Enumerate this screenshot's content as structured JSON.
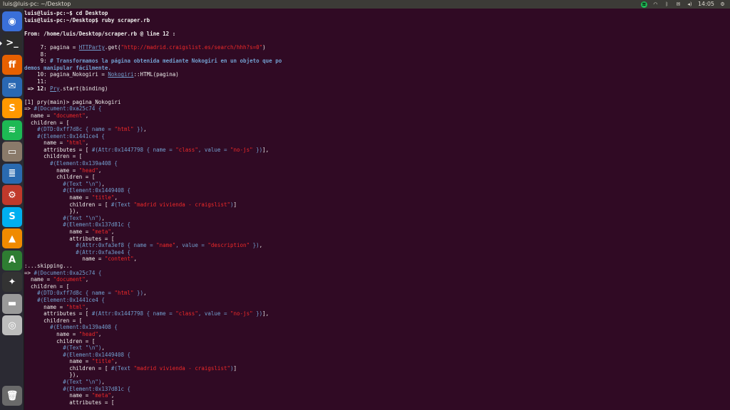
{
  "window_title": "luis@luis-pc: ~/Desktop",
  "clock": "14:05",
  "tray_icons": [
    "spotify-icon",
    "wifi-icon",
    "bluetooth-icon",
    "mail-icon",
    "volume-icon",
    "power-icon"
  ],
  "launcher": [
    {
      "name": "dash-home-icon",
      "glyph": "◉",
      "color": "#3a6fd8"
    },
    {
      "name": "terminal-icon",
      "glyph": ">_",
      "color": "#2c2c2c"
    },
    {
      "name": "firefox-icon",
      "glyph": "ff",
      "color": "#e66000"
    },
    {
      "name": "thunderbird-icon",
      "glyph": "✉",
      "color": "#2a68b3"
    },
    {
      "name": "sublime-text-icon",
      "glyph": "S",
      "color": "#ff9800"
    },
    {
      "name": "spotify-icon",
      "glyph": "≋",
      "color": "#1db954"
    },
    {
      "name": "files-icon",
      "glyph": "▭",
      "color": "#8a7a6a"
    },
    {
      "name": "writer-icon",
      "glyph": "≣",
      "color": "#2a6ab0"
    },
    {
      "name": "system-settings-icon",
      "glyph": "⚙",
      "color": "#c0392b"
    },
    {
      "name": "skype-icon",
      "glyph": "S",
      "color": "#00aff0"
    },
    {
      "name": "vlc-icon",
      "glyph": "▲",
      "color": "#f08a00"
    },
    {
      "name": "software-updater-icon",
      "glyph": "A",
      "color": "#2e7d32"
    },
    {
      "name": "inkscape-icon",
      "glyph": "✦",
      "color": "#333333"
    },
    {
      "name": "drive-icon",
      "glyph": "▬",
      "color": "#9a9a9a"
    },
    {
      "name": "dvd-icon",
      "glyph": "◎",
      "color": "#bdbdbd"
    },
    {
      "name": "trash-icon",
      "glyph": "🗑",
      "color": "#6a6a6a"
    }
  ],
  "terminal": {
    "cmd1": "luis@luis-pc:~$ cd Desktop",
    "cmd2": "luis@luis-pc:~/Desktop$ ruby scraper.rb",
    "from": "From: /home/luis/Desktop/scraper.rb @ line 12 :",
    "l7a": "     7: pagina = ",
    "l7b": "HTTParty",
    "l7c": ".get(",
    "l7d": "\"http://madrid.craigslist.es/search/hhh?s=0\"",
    "l7e": ")",
    "l8": "     8:",
    "l9a": "     9: ",
    "l9b": "# Transformamos la página obtenida mediante Nokogiri en un objeto que po",
    "l9c": "demos manipular fácilmente.",
    "l10a": "    10: pagina_Nokogiri = ",
    "l10b": "Nokogiri",
    "l10c": "::HTML(pagina)",
    "l11": "    11:",
    "l12a": " => 12: ",
    "l12b": "Pry",
    "l12c": ".start(binding)",
    "pry": "[1] pry(main)> pagina_Nokogiri",
    "skipping": ":...skipping..."
  }
}
